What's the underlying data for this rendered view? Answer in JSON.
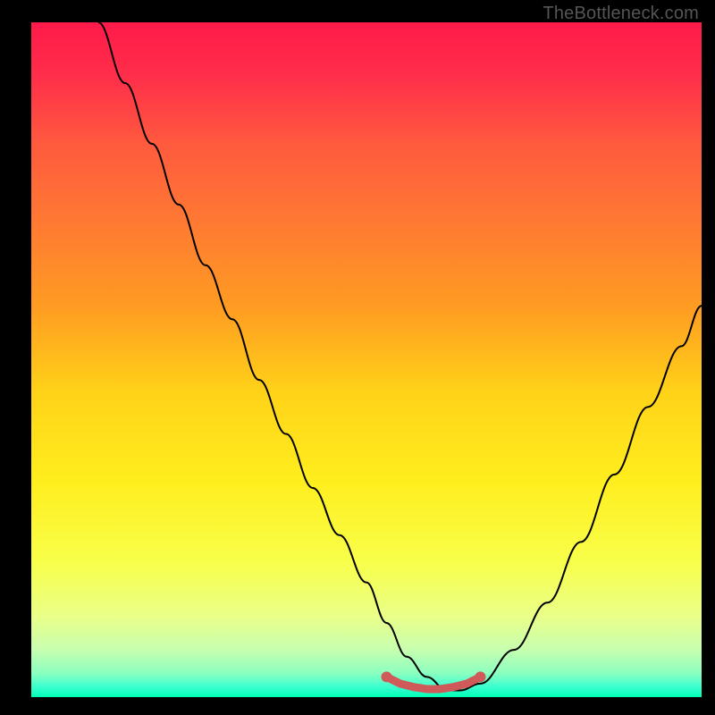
{
  "watermark": "TheBottleneck.com",
  "gradient": {
    "stops": [
      {
        "offset": 0.0,
        "color": "#ff1a4a"
      },
      {
        "offset": 0.08,
        "color": "#ff2e4a"
      },
      {
        "offset": 0.18,
        "color": "#ff5a3e"
      },
      {
        "offset": 0.3,
        "color": "#ff7a32"
      },
      {
        "offset": 0.42,
        "color": "#ff9b22"
      },
      {
        "offset": 0.55,
        "color": "#ffd318"
      },
      {
        "offset": 0.68,
        "color": "#ffee1e"
      },
      {
        "offset": 0.8,
        "color": "#f8ff4a"
      },
      {
        "offset": 0.88,
        "color": "#eaff88"
      },
      {
        "offset": 0.93,
        "color": "#c7ffb0"
      },
      {
        "offset": 0.965,
        "color": "#8affc0"
      },
      {
        "offset": 0.985,
        "color": "#3affcf"
      },
      {
        "offset": 1.0,
        "color": "#00ffb7"
      }
    ]
  },
  "chart_data": {
    "type": "line",
    "title": "",
    "xlabel": "",
    "ylabel": "",
    "xlim": [
      0,
      100
    ],
    "ylim": [
      0,
      100
    ],
    "series": [
      {
        "name": "bottleneck-curve",
        "x": [
          10,
          14,
          18,
          22,
          26,
          30,
          34,
          38,
          42,
          46,
          50,
          53,
          56,
          59,
          62,
          64,
          67,
          72,
          77,
          82,
          87,
          92,
          97,
          100
        ],
        "y": [
          100,
          91,
          82,
          73,
          64,
          56,
          47,
          39,
          31,
          24,
          17,
          11,
          6,
          3,
          1,
          1,
          2,
          7,
          14,
          23,
          33,
          43,
          52,
          58
        ]
      },
      {
        "name": "flat-bottom-marker",
        "x": [
          53,
          55,
          57,
          59,
          61,
          63,
          65,
          67
        ],
        "y": [
          3,
          2,
          1.5,
          1.2,
          1.2,
          1.5,
          2,
          3
        ]
      }
    ]
  },
  "style": {
    "curve_stroke": "#000000",
    "marker_stroke": "#d05a5a",
    "marker_fill": "#d05a5a"
  }
}
